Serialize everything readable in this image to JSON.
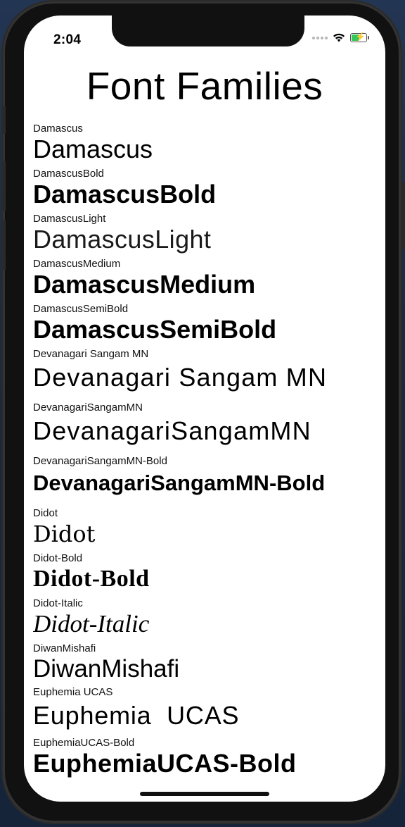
{
  "status_bar": {
    "time": "2:04"
  },
  "screen": {
    "title": "Font Families"
  },
  "fonts": [
    {
      "label": "Damascus",
      "sample": "Damascus"
    },
    {
      "label": "DamascusBold",
      "sample": "DamascusBold"
    },
    {
      "label": "DamascusLight",
      "sample": "DamascusLight"
    },
    {
      "label": "DamascusMedium",
      "sample": "DamascusMedium"
    },
    {
      "label": "DamascusSemiBold",
      "sample": "DamascusSemiBold"
    },
    {
      "label": "Devanagari Sangam MN",
      "sample": "Devanagari Sangam MN"
    },
    {
      "label": "DevanagariSangamMN",
      "sample": "DevanagariSangamMN"
    },
    {
      "label": "DevanagariSangamMN-Bold",
      "sample": "DevanagariSangamMN-Bold"
    },
    {
      "label": "Didot",
      "sample": "Didot"
    },
    {
      "label": "Didot-Bold",
      "sample": "Didot-Bold"
    },
    {
      "label": "Didot-Italic",
      "sample": "Didot-Italic"
    },
    {
      "label": "DiwanMishafi",
      "sample": "DiwanMishafi"
    },
    {
      "label": "Euphemia UCAS",
      "sample": "Euphemia  UCAS"
    },
    {
      "label": "EuphemiaUCAS-Bold",
      "sample": "EuphemiaUCAS-Bold"
    }
  ],
  "colors": {
    "background": "#ffffff",
    "text": "#000000",
    "battery_fill": "#34c759"
  }
}
